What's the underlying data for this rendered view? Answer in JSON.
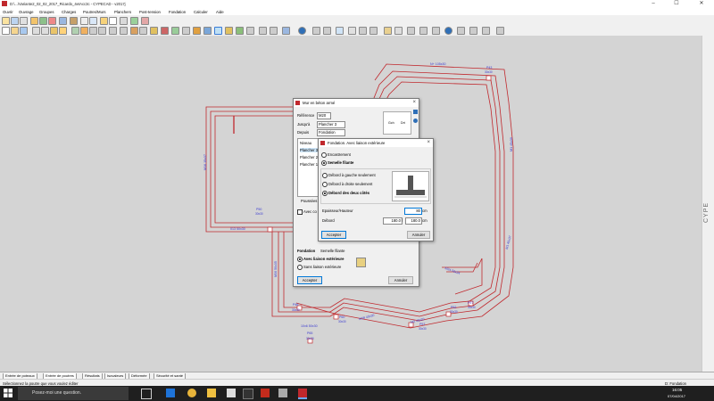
{
  "window": {
    "title": "D:\\...\\Variante2_02_02_2017_Ricardo_4etAcc3c - CYPECAD - v2017j",
    "minimize_glyph": "–",
    "maximize_glyph": "☐",
    "close_glyph": "✕"
  },
  "menu": [
    "Ouvrir",
    "Ouvrage",
    "Groupes",
    "Charges",
    "Poutres/Murs",
    "Planchers",
    "Post-tension",
    "Fondation",
    "Calculer",
    "Aide"
  ],
  "side_label": "CYPE",
  "canvas_labels": {
    "n_top": "N+ 105x30",
    "p_top": "P43",
    "p43_sub": "30x30",
    "left_vert": "M16 15x37",
    "right_vert": "M1 45x30",
    "right_vert2": "M1 45x37",
    "p50": "P50",
    "p50_sub": "30x30",
    "dim_013": "013 50x30",
    "m30": "M30 50x35",
    "p46": "P46",
    "p46_sub": "30x30",
    "p60": "P60",
    "p60_sub": "30x30",
    "p65": "P65",
    "p65_sub": "30x30",
    "m28": "M28 45x30",
    "nc": "10x6 50x30",
    "m2a": "M2 45x20",
    "p5": "P57",
    "p5_sub": "30x30",
    "p52": "P52",
    "p52_sub": "30x30",
    "p58": "P58",
    "p58_sub": "30x30",
    "p57": "P57",
    "p57_sub": "30x30",
    "m24": "M24 50x24",
    "p59": "P59",
    "small1": "3x3",
    "right_lab": "M1 45x30"
  },
  "dlg_mur": {
    "title": "Mur en béton armé",
    "reference_label": "Référence",
    "reference_value": "M20",
    "jusqua_label": "Jusqu'à",
    "jusqua_value": "Plancher 3",
    "depuis_label": "Depuis",
    "depuis_value": "Fondation",
    "niveau_header": "Niveau",
    "rows": [
      "Plancher 3",
      "Plancher 2",
      "Plancher 1"
    ],
    "diag_g": "Gch",
    "diag_d": "Drt",
    "poussees_label": "Poussées",
    "avec_label": "Avec co",
    "fondation_label": "Fondation",
    "fondation_value": "Semelle filante",
    "avec_liaison": "Avec liaison extérieure",
    "sans_liaison": "Sans liaison extérieure",
    "accept": "Accepter",
    "cancel": "Annuler"
  },
  "dlg_fond": {
    "title": "Fondation. Avec liaison extérieure",
    "opt1": "Encastrement",
    "opt2": "Semelle filante",
    "d1": "Débord à gauche seulement",
    "d2": "Débord à droite seulement",
    "d3": "Débord des deux côtés",
    "ep_label": "Epaisseur/Hauteur",
    "ep_value": "80",
    "ep_unit": "cm",
    "deb_label": "Débord",
    "deb_left": "180.0",
    "deb_sep": "/",
    "deb_right": "180.0",
    "deb_unit": "cm",
    "accept": "Accepter",
    "cancel": "Annuler"
  },
  "tabs": [
    "Entrée de poteaux",
    "Entrée de poutres",
    "Résultats",
    "Isovaleurs",
    "Déformée",
    "Sécurité et santé"
  ],
  "status_left": "Sélectionnez la poutre que vous voulez éditer",
  "status_right": "D: Fondation",
  "taskbar": {
    "search_placeholder": "Posez-moi une question.",
    "time": "16:05",
    "date": "07/04/2017"
  }
}
